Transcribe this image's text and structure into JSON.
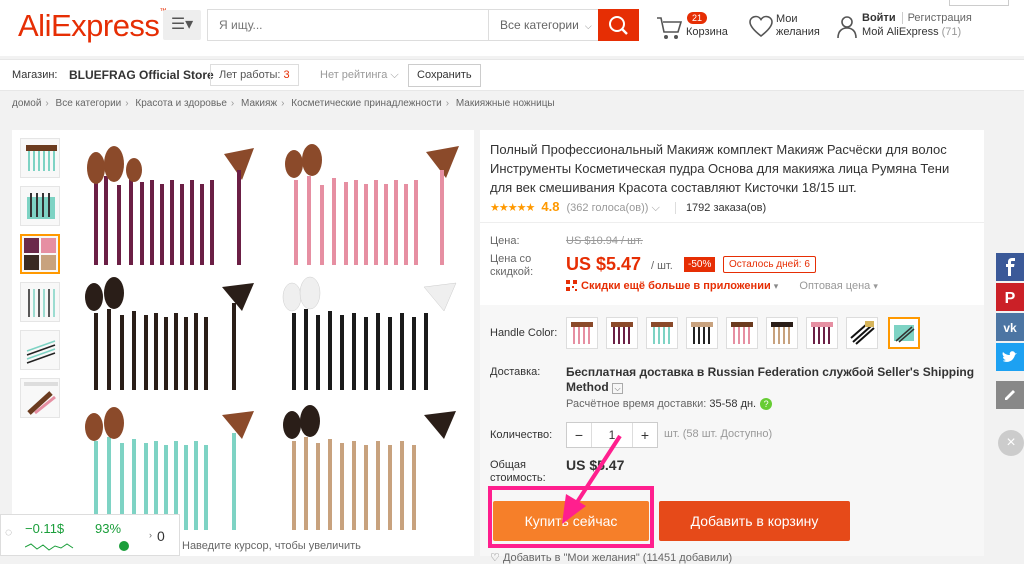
{
  "header": {
    "logo": "AliExpress",
    "logo_tm": "™",
    "menu_icon": "hamburger-icon",
    "search_placeholder": "Я ищу...",
    "search_category": "Все категории",
    "cart_count": "21",
    "cart_label": "Корзина",
    "wishlist_label_1": "Мои",
    "wishlist_label_2": "желания",
    "signin": "Войти",
    "register": "Регистрация",
    "my_ali": "Мой AliExpress",
    "my_ali_count": "(71)",
    "colors": {
      "brand": "#e62e04"
    }
  },
  "store": {
    "prefix": "Магазин:",
    "name": "BLUEFRAG Official Store",
    "years_label": "Лет работы:",
    "years_value": "3",
    "rating": "Нет рейтинга",
    "save": "Сохранить"
  },
  "breadcrumb": [
    "домой",
    "Все категории",
    "Красота и здоровье",
    "Макияж",
    "Косметические принадлежности",
    "Макияжные ножницы"
  ],
  "gallery": {
    "zoom_hint": "Наведите курсор, чтобы увеличить"
  },
  "product": {
    "title": "Полный Профессиональный Макияж комплект Макияж Расчёски для волос Инструменты Косметическая пудра Основа для макияжа лица Румяна Тени для век смешивания Красота составляют Кисточки 18/15 шт.",
    "rating_value": "4.8",
    "votes": "(362 голоса(ов))",
    "orders": "1792 заказа(ов)",
    "price_label": "Цена:",
    "old_price": "US $10.94 / шт.",
    "discount_label_1": "Цена со",
    "discount_label_2": "скидкой:",
    "new_price": "US $5.47",
    "per_unit": "/ шт.",
    "discount": "-50%",
    "days_left": "Осталось дней: 6",
    "app_offer": "Скидки ещё больше в приложении",
    "wholesale": "Оптовая цена"
  },
  "options": {
    "handle_color_label": "Handle Color:",
    "shipping_label": "Доставка:",
    "shipping_title": "Бесплатная доставка в Russian Federation службой Seller's Shipping Method",
    "ship_time_label": "Расчётное время доставки:",
    "ship_time_value": "35-58 дн.",
    "qty_label": "Количество:",
    "qty_value": "1",
    "qty_note": "шт. (58 шт. Доступно)",
    "total_label_1": "Общая",
    "total_label_2": "стоимость:",
    "total_value": "US $5.47",
    "buy_now": "Купить сейчас",
    "add_to_cart": "Добавить в корзину",
    "add_wish": "Добавить в \"Мои желания\" (11451 добавили)"
  },
  "ticker": {
    "value": "−0.11$",
    "percent": "93%",
    "zero": "0"
  }
}
